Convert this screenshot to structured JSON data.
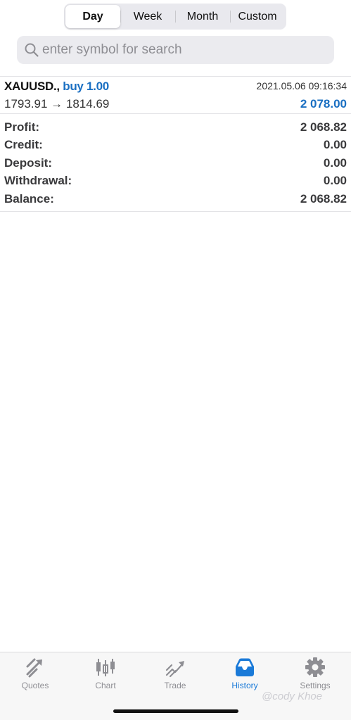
{
  "segments": {
    "day": "Day",
    "week": "Week",
    "month": "Month",
    "custom": "Custom"
  },
  "search": {
    "placeholder": "enter symbol for search",
    "icon": "search-icon"
  },
  "deal": {
    "symbol": "XAUUSD., ",
    "type": "buy 1.00",
    "time": "2021.05.06 09:16:34",
    "prices": "1793.91 → 1814.69",
    "profit": "2 078.00"
  },
  "summary": {
    "profit_label": "Profit:",
    "profit_value": "2 068.82",
    "credit_label": "Credit:",
    "credit_value": "0.00",
    "deposit_label": "Deposit:",
    "deposit_value": "0.00",
    "withdrawal_label": "Withdrawal:",
    "withdrawal_value": "0.00",
    "balance_label": "Balance:",
    "balance_value": "2 068.82"
  },
  "tabs": {
    "quotes": "Quotes",
    "chart": "Chart",
    "trade": "Trade",
    "history": "History",
    "settings": "Settings"
  },
  "watermark": "@cody Khoe",
  "colors": {
    "accent": "#1a7ad8",
    "inactive": "#8e8e93"
  }
}
